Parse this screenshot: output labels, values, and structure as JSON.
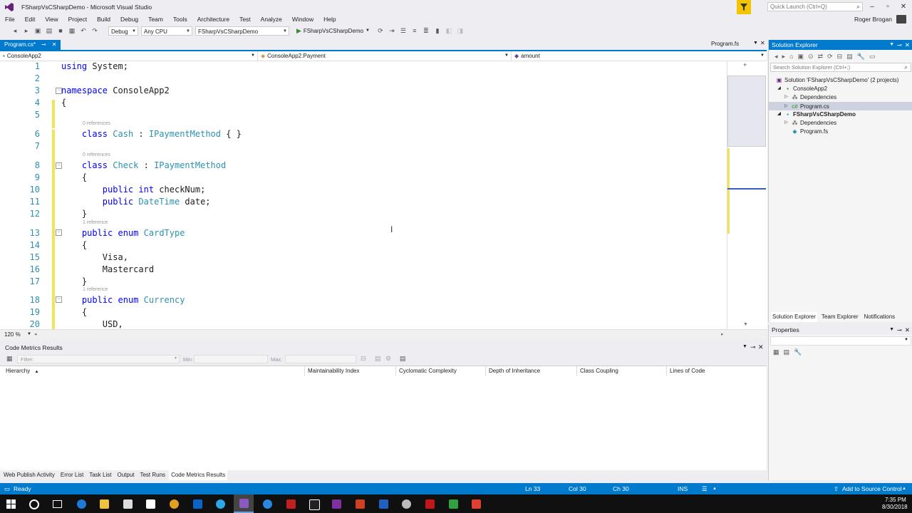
{
  "window": {
    "title": "FSharpVsCSharpDemo - Microsoft Visual Studio",
    "quick_launch_placeholder": "Quick Launch (Ctrl+Q)",
    "user": "Roger Brogan"
  },
  "menu": [
    "File",
    "Edit",
    "View",
    "Project",
    "Build",
    "Debug",
    "Team",
    "Tools",
    "Architecture",
    "Test",
    "Analyze",
    "Window",
    "Help"
  ],
  "toolbar": {
    "config": "Debug",
    "platform": "Any CPU",
    "startup_project": "FSharpVsCSharpDemo",
    "run_label": "FSharpVsCSharpDemo"
  },
  "doc_tabs": {
    "active": "Program.cs*",
    "right": "Program.fs"
  },
  "nav": {
    "project": "ConsoleApp2",
    "type": "ConsoleApp2.Payment",
    "member": "amount"
  },
  "editor": {
    "zoom": "120 %",
    "lens_zero": "0 references",
    "lens_one": "1 reference"
  },
  "solution_explorer": {
    "title": "Solution Explorer",
    "search_placeholder": "Search Solution Explorer (Ctrl+;)",
    "items": [
      "Solution 'FSharpVsCSharpDemo' (2 projects)",
      "ConsoleApp2",
      "Dependencies",
      "Program.cs",
      "FSharpVsCSharpDemo",
      "Dependencies",
      "Program.fs"
    ],
    "tabs": [
      "Solution Explorer",
      "Team Explorer",
      "Notifications"
    ]
  },
  "properties": {
    "title": "Properties"
  },
  "code_metrics": {
    "title": "Code Metrics Results",
    "filter_placeholder": "Filter:",
    "min_label": "Min:",
    "max_label": "Max:",
    "columns": [
      "Hierarchy",
      "Maintainability Index",
      "Cyclomatic Complexity",
      "Depth of Inheritance",
      "Class Coupling",
      "Lines of Code"
    ]
  },
  "bottom_tabs": [
    "Web Publish Activity",
    "Error List",
    "Task List",
    "Output",
    "Test Runs",
    "Code Metrics Results"
  ],
  "status": {
    "state": "Ready",
    "line": "Ln 33",
    "col": "Col 30",
    "ch": "Ch 30",
    "mode": "INS",
    "source_control": "Add to Source Control"
  },
  "clock": {
    "time": "7:35 PM",
    "date": "8/30/2018"
  },
  "colors": {
    "accent": "#007acc",
    "keyword": "#0000ff",
    "type": "#2b91af",
    "change_margin": "#f2e35b"
  }
}
